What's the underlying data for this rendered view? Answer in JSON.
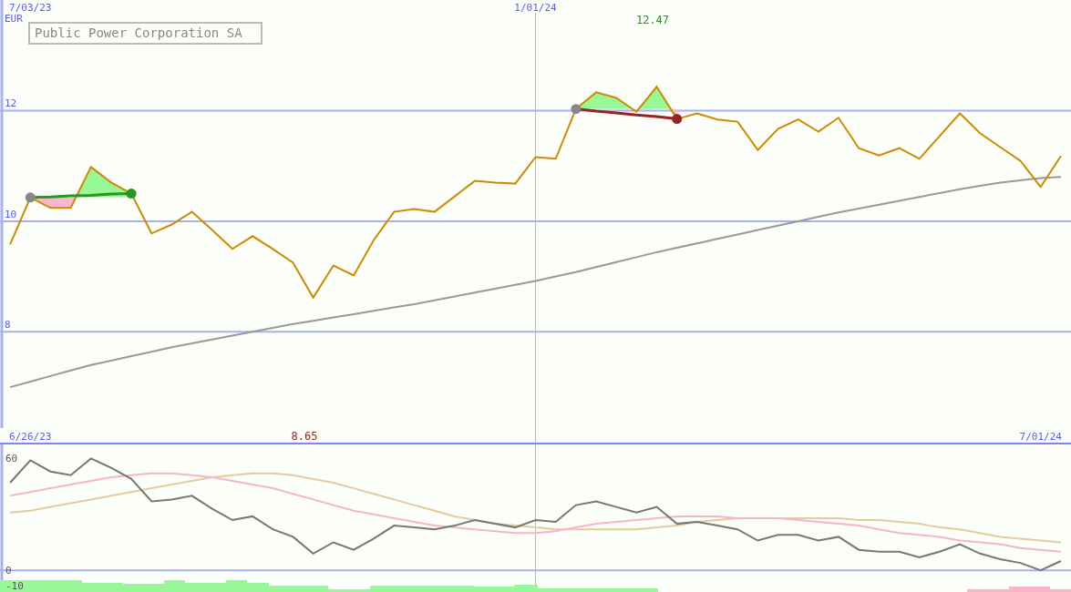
{
  "title": "Public Power Corporation SA",
  "price_chart": {
    "high_value": "12.47",
    "low_value": "8.65",
    "chart_data": {
      "type": "line",
      "ylabel": "EUR",
      "categories": [
        null,
        "7/03/23",
        null,
        null,
        null,
        null,
        null,
        null,
        null,
        null,
        null,
        null,
        null,
        null,
        null,
        null,
        null,
        null,
        null,
        null,
        null,
        null,
        null,
        null,
        null,
        null,
        "1/01/24",
        null,
        null,
        null,
        null,
        null,
        null,
        null,
        null,
        null,
        null,
        null,
        null,
        null,
        null,
        null,
        null,
        null,
        null,
        null,
        null,
        null,
        null,
        null,
        null,
        null,
        null
      ],
      "ylim": [
        6.26,
        14
      ],
      "yticks": [
        8,
        10,
        12
      ],
      "grid": true,
      "series": [
        {
          "color": "#d08a00",
          "values": [
            9.58,
            10.43,
            10.24,
            10.24,
            10.98,
            10.7,
            10.5,
            9.78,
            9.94,
            10.17,
            9.84,
            9.5,
            9.73,
            9.5,
            9.25,
            8.62,
            9.2,
            9.02,
            9.66,
            10.17,
            10.22,
            10.17,
            10.45,
            10.73,
            10.7,
            10.68,
            11.16,
            11.13,
            12.03,
            12.33,
            12.23,
            11.98,
            12.43,
            11.85,
            11.95,
            11.84,
            11.8,
            11.29,
            11.67,
            11.84,
            11.62,
            11.87,
            11.32,
            11.19,
            11.32,
            11.13,
            11.54,
            11.95,
            11.59,
            11.34,
            11.09,
            10.62,
            11.18
          ]
        },
        {
          "color": "#999999",
          "values": [
            7.0,
            7.1,
            7.2,
            7.3,
            7.4,
            7.48,
            7.56,
            7.64,
            7.72,
            7.79,
            7.86,
            7.93,
            8.0,
            8.07,
            8.14,
            8.2,
            8.26,
            8.32,
            8.38,
            8.44,
            8.5,
            8.57,
            8.64,
            8.71,
            8.78,
            8.85,
            8.92,
            9.0,
            9.08,
            9.17,
            9.26,
            9.35,
            9.44,
            9.52,
            9.6,
            9.68,
            9.76,
            9.84,
            9.92,
            10.0,
            10.08,
            10.16,
            10.23,
            10.3,
            10.37,
            10.44,
            10.51,
            10.58,
            10.64,
            10.7,
            10.74,
            10.78,
            10.8
          ]
        },
        {
          "color": "#229922",
          "values": [
            null,
            10.43,
            10.44,
            10.46,
            10.47,
            10.49,
            10.5,
            null,
            null,
            null,
            null,
            null,
            null,
            null,
            null,
            null,
            null,
            null,
            null,
            null,
            null,
            null,
            null,
            null,
            null,
            null,
            null,
            null,
            null,
            null,
            null,
            null,
            null,
            null,
            null,
            null,
            null,
            null,
            null,
            null,
            null,
            null,
            null,
            null,
            null,
            null,
            null,
            null,
            null,
            null,
            null,
            null,
            null
          ]
        },
        {
          "color": "#992222",
          "values": [
            null,
            null,
            null,
            null,
            null,
            null,
            null,
            null,
            null,
            null,
            null,
            null,
            null,
            null,
            null,
            null,
            null,
            null,
            null,
            null,
            null,
            null,
            null,
            null,
            null,
            null,
            null,
            null,
            12.03,
            11.99,
            11.96,
            11.92,
            11.89,
            11.85,
            null,
            null,
            null,
            null,
            null,
            null,
            null,
            null,
            null,
            null,
            null,
            null,
            null,
            null,
            null,
            null,
            null,
            null,
            null
          ]
        }
      ]
    }
  },
  "oscillator_chart": {
    "histogram_label": "-10",
    "chart_data": {
      "type": "line",
      "categories": [
        null,
        "6/26/23",
        null,
        null,
        null,
        null,
        null,
        null,
        null,
        null,
        null,
        null,
        null,
        null,
        null,
        null,
        null,
        null,
        null,
        null,
        null,
        null,
        null,
        null,
        null,
        null,
        null,
        null,
        null,
        null,
        null,
        null,
        null,
        null,
        null,
        null,
        null,
        null,
        null,
        null,
        null,
        null,
        null,
        null,
        null,
        null,
        null,
        null,
        null,
        null,
        null,
        "7/01/24",
        null
      ],
      "ylim": [
        -11.6,
        68
      ],
      "yticks": [
        0,
        60
      ],
      "ref_lines": [
        {
          "axis": "y",
          "value": 0
        }
      ],
      "series": [
        {
          "color": "#777777",
          "values": [
            47,
            59,
            53,
            51,
            60,
            55,
            49,
            37,
            38,
            40,
            33,
            27,
            29,
            22,
            18,
            9,
            15,
            11,
            17,
            24,
            23,
            22,
            24,
            27,
            25,
            23,
            27,
            26,
            35,
            37,
            34,
            31,
            34,
            25,
            26,
            24,
            22,
            16,
            19,
            19,
            16,
            18,
            11,
            10,
            10,
            7,
            10,
            14,
            9,
            6,
            4,
            0,
            5
          ]
        },
        {
          "color": "#f8b4c8",
          "values": [
            40,
            42,
            44,
            46,
            48,
            50,
            51,
            52,
            52,
            51,
            50,
            48,
            46,
            44,
            41,
            38,
            35,
            32,
            30,
            28,
            26,
            24,
            23,
            22,
            21,
            20,
            20,
            21,
            23,
            25,
            26,
            27,
            28,
            29,
            29,
            29,
            28,
            28,
            28,
            27,
            26,
            25,
            24,
            22,
            20,
            19,
            18,
            16,
            15,
            14,
            12,
            11,
            10
          ]
        },
        {
          "color": "#e4cc9c",
          "values": [
            31,
            32,
            34,
            36,
            38,
            40,
            42,
            44,
            46,
            48,
            50,
            51,
            52,
            52,
            51,
            49,
            47,
            44,
            41,
            38,
            35,
            32,
            29,
            27,
            25,
            24,
            23,
            22,
            22,
            22,
            22,
            22,
            23,
            24,
            26,
            27,
            28,
            28,
            28,
            28,
            28,
            28,
            27,
            27,
            26,
            25,
            23,
            22,
            20,
            18,
            17,
            16,
            15
          ]
        }
      ]
    }
  }
}
